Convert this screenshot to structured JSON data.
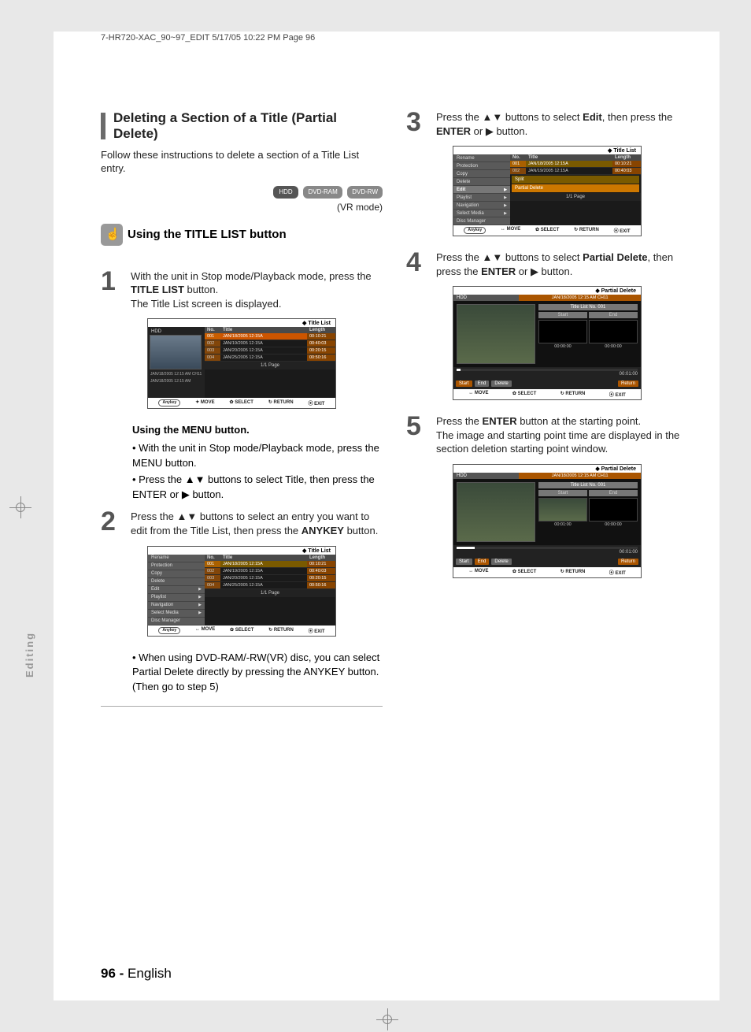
{
  "print_header": "7-HR720-XAC_90~97_EDIT  5/17/05  10:22 PM  Page 96",
  "title": "Deleting a Section of a Title (Partial Delete)",
  "intro": "Follow these instructions to delete a section of a Title List entry.",
  "badges": {
    "hdd": "HDD",
    "ram": "DVD-RAM",
    "rw": "DVD-RW"
  },
  "vr_mode": "(VR mode)",
  "subheading": "Using the TITLE LIST button",
  "side_label": "Editing",
  "steps": {
    "s1a": "With the unit in Stop mode/Playback mode, press the ",
    "s1b": "TITLE LIST",
    "s1c": " button.",
    "s1d": "The Title List screen is displayed.",
    "menu_head": "Using the MENU button.",
    "menu_b1a": "With the unit in Stop mode/Playback mode, press the ",
    "menu_b1b": "MENU",
    "menu_b1c": " button.",
    "menu_b2a": "Press the ▲▼ buttons to select ",
    "menu_b2b": "Title",
    "menu_b2c": ", then press the ",
    "menu_b2d": "ENTER",
    "menu_b2e": " or ▶ button.",
    "s2a": "Press the ▲▼ buttons to select an entry you want to edit from the Title List, then press the ",
    "s2b": "ANYKEY",
    "s2c": " button.",
    "note2": "When using DVD-RAM/-RW(VR) disc, you can select Partial Delete directly by pressing the ANYKEY button.\n(Then go to step 5)",
    "s3a": "Press the ▲▼ buttons to select ",
    "s3b": "Edit",
    "s3c": ", then press the ",
    "s3d": "ENTER",
    "s3e": " or ▶ button.",
    "s4a": "Press the ▲▼ buttons to select ",
    "s4b": "Partial Delete",
    "s4c": ", then press the ",
    "s4d": "ENTER",
    "s4e": " or ▶ button.",
    "s5a": "Press the ",
    "s5b": "ENTER",
    "s5c": " button at the starting point.",
    "s5d": "The image and starting point time are displayed in the section deletion starting point window."
  },
  "osd": {
    "title_list": "Title List",
    "hdd_label": "HDD",
    "headers": {
      "no": "No.",
      "title": "Title",
      "length": "Length"
    },
    "rows": [
      {
        "no": "001",
        "title": "JAN/18/2005 12:15A",
        "len": "00:10:21"
      },
      {
        "no": "002",
        "title": "JAN/19/2005 12:15A",
        "len": "00:40:03"
      },
      {
        "no": "003",
        "title": "JAN/20/2005 12:15A",
        "len": "00:20:15"
      },
      {
        "no": "004",
        "title": "JAN/25/2005 12:15A",
        "len": "00:50:16"
      }
    ],
    "meta1": "JAN/18/2005 12:15 AM CH11",
    "meta2": "JAN/18/2005 12:15 AM",
    "page": "1/1 Page",
    "help": {
      "anykey": "Anykey",
      "move": "MOVE",
      "select": "SELECT",
      "return": "RETURN",
      "exit": "EXIT"
    },
    "menu": {
      "rename": "Rename",
      "protection": "Protection",
      "copy": "Copy",
      "delete": "Delete",
      "edit": "Edit",
      "playlist": "Playlist",
      "navigation": "Navigation",
      "select_media": "Select Media",
      "disc_manager": "Disc Manager",
      "split": "Split",
      "partial_delete": "Partial Delete"
    },
    "pd": {
      "title": "Partial Delete",
      "rec_label": "JAN/18/2005 12:15 AM CH11",
      "list_no": "Title List No. 001",
      "start": "Start",
      "end": "End",
      "t0": "00:00:00",
      "t1": "00:01:00",
      "t_total": "00:01:00",
      "btn_start": "Start",
      "btn_end": "End",
      "btn_delete": "Delete",
      "btn_return": "Return"
    }
  },
  "footer": {
    "page_num": "96 -",
    "lang": "English"
  }
}
